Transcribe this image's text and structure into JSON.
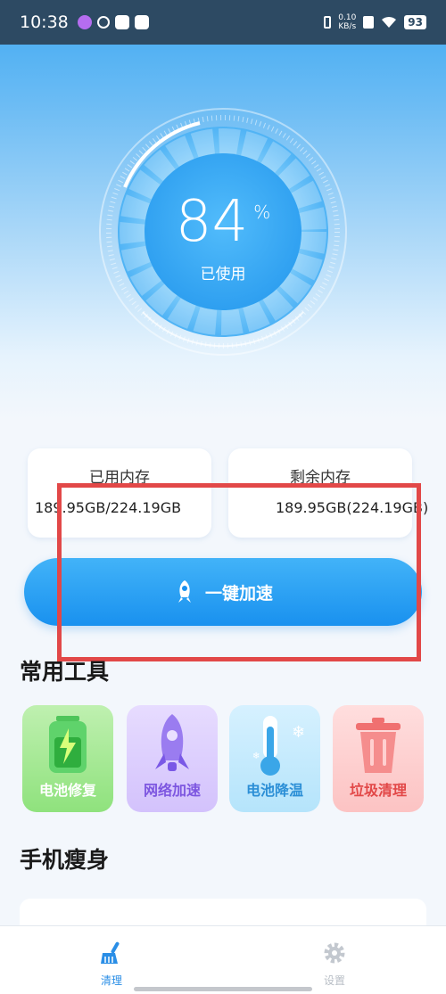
{
  "status_bar": {
    "time": "10:38",
    "net_speed_value": "0.10",
    "net_speed_unit": "KB/s",
    "battery": "93"
  },
  "gauge": {
    "percent_value": "84",
    "percent_sign": "%",
    "usage_fraction": 0.84,
    "label": "已使用"
  },
  "memory": {
    "used": {
      "title": "已用内存",
      "value": "189.95GB/224.19GB"
    },
    "free": {
      "title": "剩余内存",
      "value": "189.95GB(224.19GB)"
    }
  },
  "boost_button": {
    "label": "一键加速"
  },
  "tools_section": {
    "title": "常用工具",
    "items": [
      {
        "label": "电池修复",
        "icon": "battery-icon"
      },
      {
        "label": "网络加速",
        "icon": "rocket-icon"
      },
      {
        "label": "电池降温",
        "icon": "thermometer-icon"
      },
      {
        "label": "垃圾清理",
        "icon": "trash-icon"
      }
    ]
  },
  "slim_section": {
    "title": "手机瘦身"
  },
  "bottom_nav": {
    "items": [
      {
        "label": "清理",
        "icon": "broom-icon",
        "active": true
      },
      {
        "label": "设置",
        "icon": "gear-icon",
        "active": false
      }
    ]
  },
  "colors": {
    "accent": "#1991ef",
    "highlight": "#e24848"
  }
}
